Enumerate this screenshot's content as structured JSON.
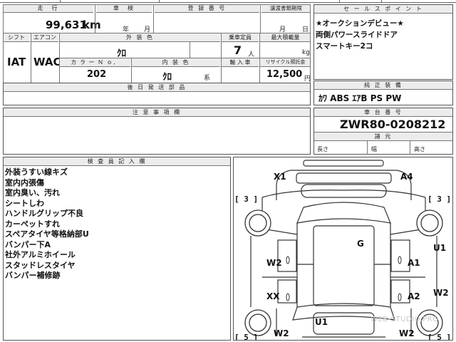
{
  "top": {
    "mileage_label": "走　行",
    "mileage_value": "99,631",
    "mileage_unit": "km",
    "inspection_label": "車　検",
    "inspection_year": "年",
    "inspection_month": "月",
    "reg_label": "登 録 番 号",
    "transfer_label": "譲渡書類期限",
    "transfer_month": "月",
    "transfer_day": "日"
  },
  "row2": {
    "shift_label": "シフト",
    "shift_value": "IAT",
    "ac_label": "エアコン",
    "ac_value": "WAC",
    "ext_color_label": "外 装 色",
    "ext_color_value": "ｸﾛ",
    "capacity_label": "乗車定員",
    "capacity_value": "7",
    "capacity_unit": "人",
    "load_label": "最大積載量",
    "load_unit": "kg",
    "color_no_label": "カ ラ ー Ｎ ｏ．",
    "color_no_value": "202",
    "int_color_label": "内 装 色",
    "int_color_value": "ｸﾛ",
    "int_color_unit": "系",
    "import_label": "輸 入 車",
    "recycle_label": "リサイクル預託金",
    "recycle_value": "12,500",
    "recycle_unit": "円"
  },
  "later_docs": {
    "label": "後 日 発 送 部 品"
  },
  "notes": {
    "label": "注 意 事 項 欄"
  },
  "sales": {
    "label": "セ ー ル ス ポ イ ン ト",
    "lines": [
      "★オークションデビュー★",
      "両側パワースライドドア",
      "スマートキー2コ"
    ]
  },
  "equipment": {
    "label": "純 正 装 備",
    "value": "ｶﾜ ABS ｴｱB PS PW"
  },
  "chassis": {
    "label": "車 台 番 号",
    "value": "ZWR80-0208212",
    "dims_label": "諸 元",
    "length_label": "長さ",
    "width_label": "幅",
    "height_label": "高さ"
  },
  "inspector": {
    "label": "検 査 員 記 入 欄",
    "items": [
      "外装うすい線キズ",
      "室内内張傷",
      "室内臭い、汚れ",
      "シートしわ",
      "ハンドルグリップ不良",
      "カーペットすれ",
      "スペアタイヤ等格納部U",
      "バンパー下A",
      "社外アルミホイール",
      "スタッドレスタイヤ",
      "バンパー補修跡"
    ]
  },
  "diagram": {
    "labels": {
      "front_left": "X1",
      "front_right": "A4",
      "left_front_door": "W2",
      "right_front_door": "A1",
      "roof": "G",
      "right_panel": "U1",
      "left_rear_door": "XX",
      "right_rear_door": "A2",
      "right_rear_panel": "W2",
      "rear_center": "U1",
      "rear_left": "W2",
      "rear_right": "W2"
    },
    "tires": {
      "front_left": "3",
      "front_right": "3",
      "rear_left": "5",
      "rear_right": "5"
    },
    "watermark": "WEB-STUDIO.PRO"
  }
}
